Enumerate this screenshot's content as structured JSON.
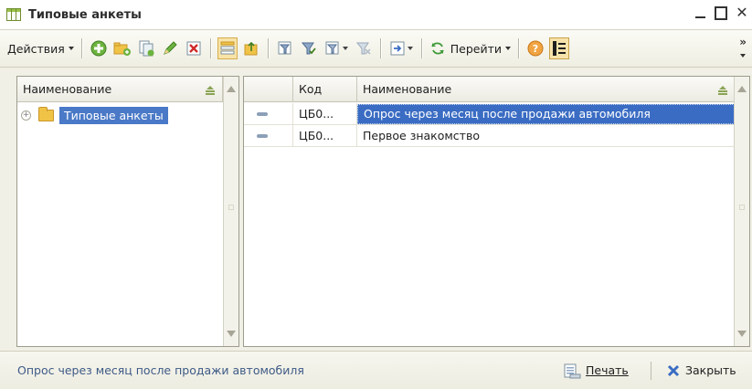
{
  "window": {
    "title": "Типовые анкеты"
  },
  "toolbar": {
    "actions_label": "Действия",
    "goto_label": "Перейти",
    "overflow_label": "»"
  },
  "left_panel": {
    "header": "Наименование",
    "tree": [
      {
        "label": "Типовые анкеты",
        "selected": true
      }
    ]
  },
  "right_panel": {
    "columns": [
      "Код",
      "Наименование"
    ],
    "rows": [
      {
        "code": "ЦБ0...",
        "name": "Опрос через месяц после продажи автомобиля",
        "selected": true
      },
      {
        "code": "ЦБ0...",
        "name": "Первое знакомство",
        "selected": false
      }
    ]
  },
  "footer": {
    "status": "Опрос через месяц после продажи автомобиля",
    "print_label": "Печать",
    "close_label": "Закрыть"
  },
  "colors": {
    "selection": "#3a6cc3",
    "status_text": "#3d5a86",
    "toolbar_bg": "#efeee2"
  }
}
